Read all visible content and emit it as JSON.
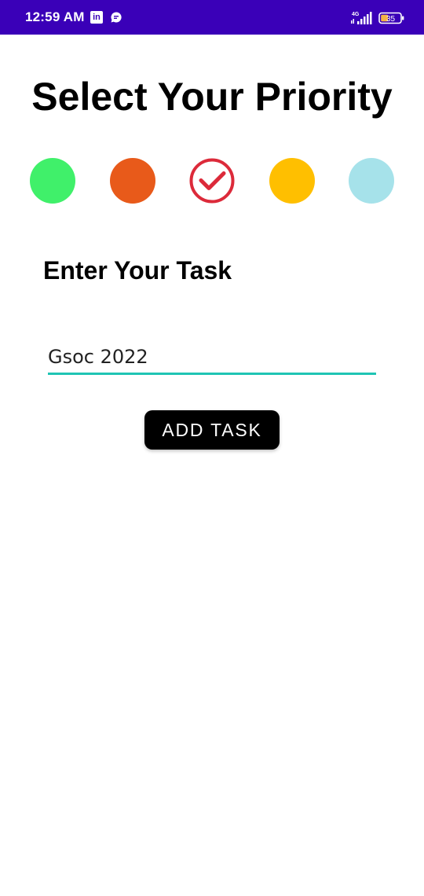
{
  "status_bar": {
    "time": "12:59 AM",
    "linkedin_icon": "linkedin-icon",
    "chat_icon": "chat-icon",
    "network_label": "4G",
    "battery_level": "35",
    "background_color": "#3a00b8"
  },
  "main": {
    "title": "Select Your Priority",
    "priorities": [
      {
        "color": "#40f06a",
        "selected": false,
        "icon": "circle"
      },
      {
        "color": "#e85a1a",
        "selected": false,
        "icon": "circle"
      },
      {
        "color": "#dc2a3a",
        "selected": true,
        "icon": "check-circle-icon"
      },
      {
        "color": "#ffbf00",
        "selected": false,
        "icon": "circle"
      },
      {
        "color": "#a6e2ea",
        "selected": false,
        "icon": "circle"
      }
    ],
    "task_label": "Enter Your Task",
    "task_input_value": "Gsoc 2022",
    "task_input_underline_color": "#1fc4b4",
    "add_task_label": "ADD TASK"
  }
}
